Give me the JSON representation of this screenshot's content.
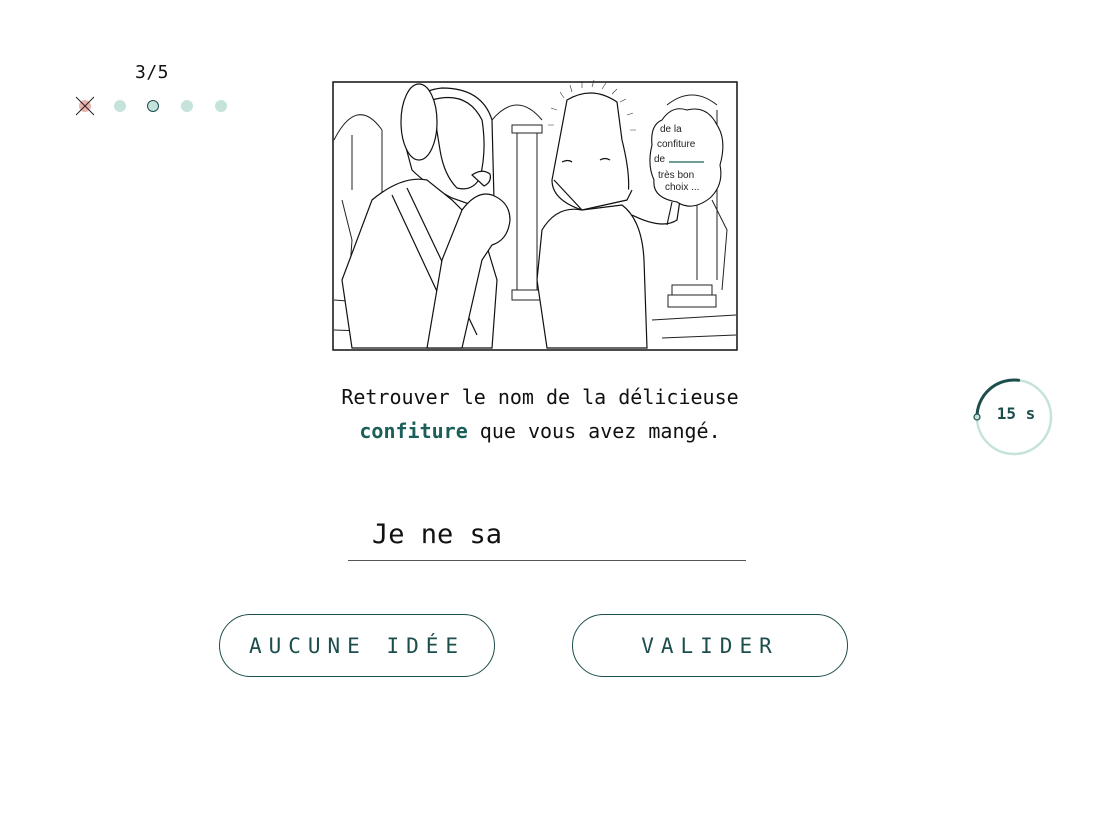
{
  "progress": {
    "label": "3/5",
    "current": 3,
    "total": 5,
    "steps": [
      "failed",
      "pending",
      "current",
      "pending",
      "pending"
    ]
  },
  "illustration": {
    "bubble_lines": [
      "de la",
      "confiture",
      "de",
      "très bon",
      "choix ..."
    ]
  },
  "question": {
    "text_before": "Retrouver le nom de la délicieuse",
    "keyword": "confiture",
    "text_after": "que vous avez mangé."
  },
  "timer": {
    "label": "15 s",
    "remaining_fraction": 0.27
  },
  "answer": {
    "value": "Je ne sa",
    "placeholder": ""
  },
  "buttons": {
    "skip_label": "AUCUNE IDÉE",
    "validate_label": "VALIDER"
  },
  "colors": {
    "accent": "#1c4e4c",
    "keyword": "#1c5f59",
    "dot_pending": "#c5e3da",
    "dot_failed": "#eab3ad"
  }
}
